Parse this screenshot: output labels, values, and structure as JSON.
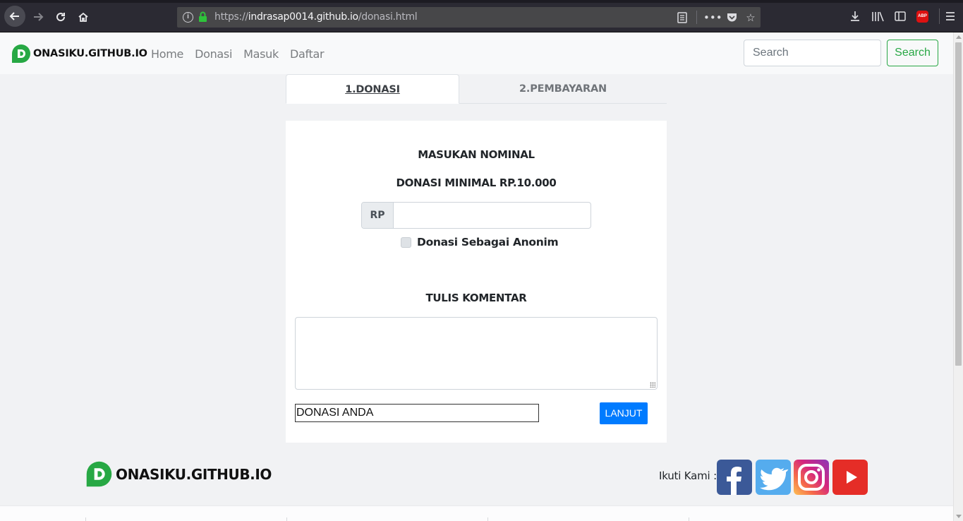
{
  "browser": {
    "url_prefix": "https://",
    "url_host": "indrasap0014.github.io",
    "url_path": "/donasi.html",
    "addon_label": "ABP"
  },
  "navbar": {
    "brand": "ONASIKU.GITHUB.IO",
    "links": [
      "Home",
      "Donasi",
      "Masuk",
      "Daftar"
    ],
    "search_placeholder": "Search",
    "search_button": "Search"
  },
  "tabs": [
    {
      "label": "1.DONASI",
      "active": true
    },
    {
      "label": "2.PEMBAYARAN",
      "active": false
    }
  ],
  "form": {
    "heading_nominal": "MASUKAN NOMINAL",
    "heading_minimal": "DONASI MINIMAL RP.10.000",
    "currency_addon": "RP",
    "amount_value": "",
    "anonymous_label": "Donasi Sebagai Anonim",
    "anonymous_checked": false,
    "heading_comment": "TULIS KOMENTAR",
    "comment_value": "",
    "donation_field_value": "DONASI ANDA",
    "submit_label": "LANJUT"
  },
  "footer": {
    "brand": "ONASIKU.GITHUB.IO",
    "follow_label": "Ikuti Kami :",
    "social_icons": [
      "facebook-icon",
      "twitter-icon",
      "instagram-icon",
      "youtube-icon"
    ]
  },
  "colors": {
    "brand_green": "#27a844",
    "primary_blue": "#007bff",
    "search_green": "#28a745"
  }
}
